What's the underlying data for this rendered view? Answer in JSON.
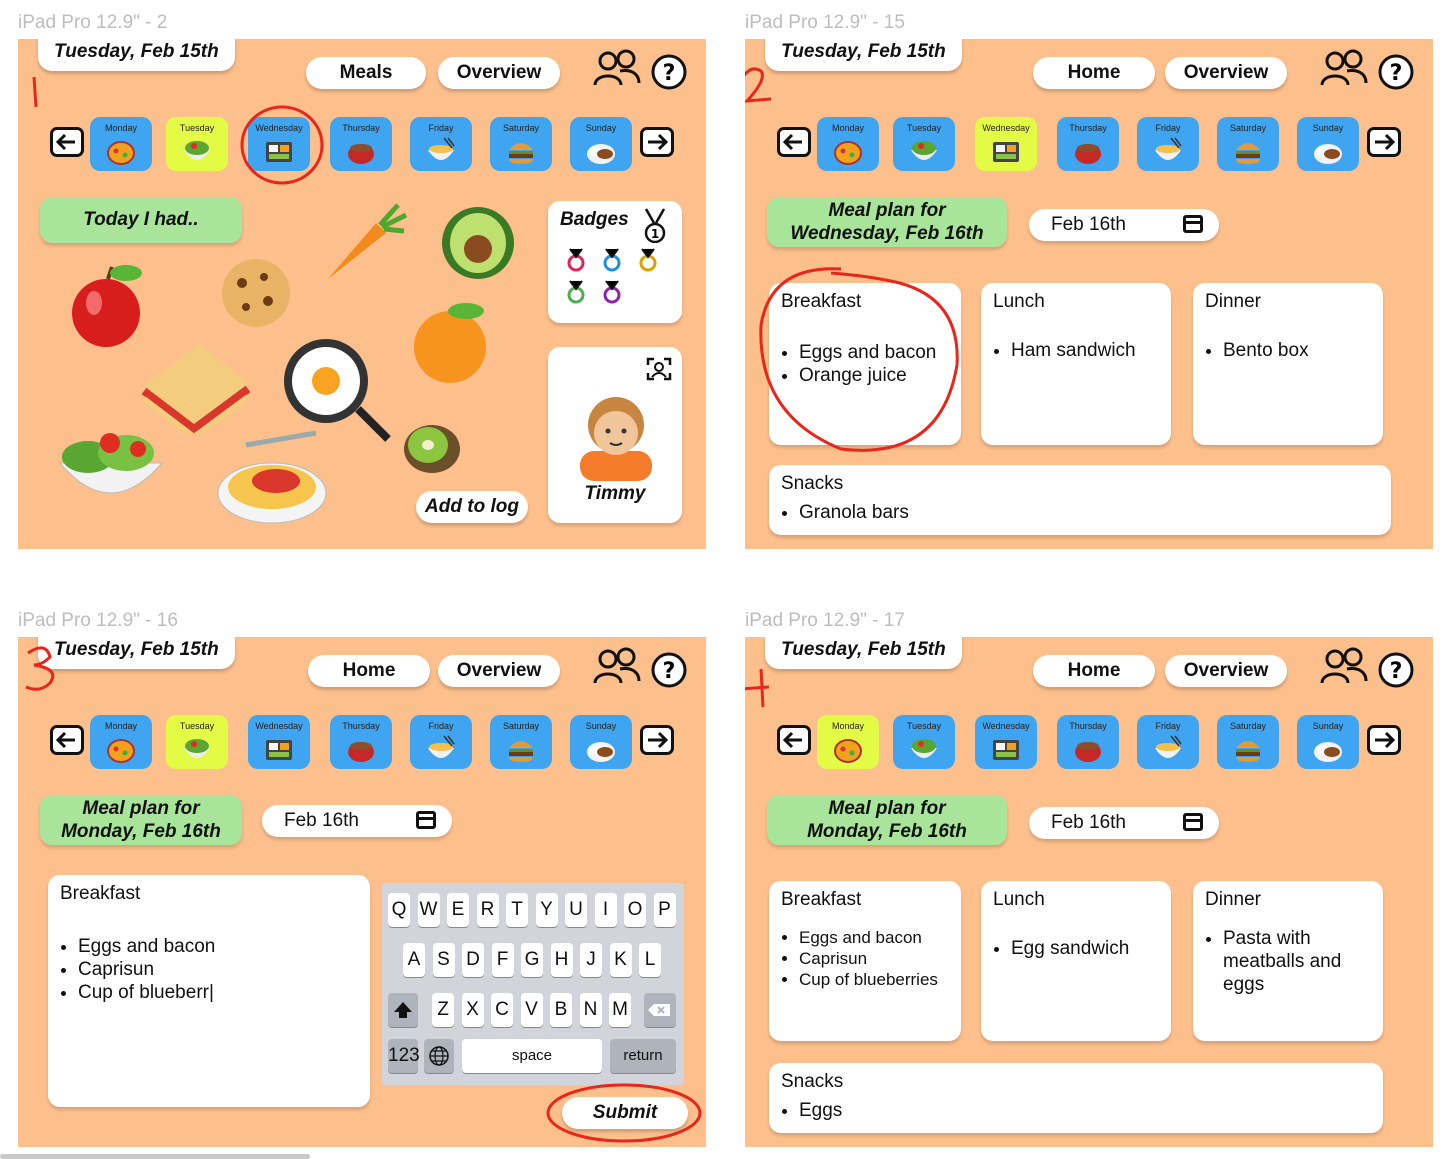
{
  "captions": [
    "iPad Pro 12.9\" - 2",
    "iPad Pro 12.9\" - 15",
    "iPad Pro 12.9\" - 16",
    "iPad Pro 12.9\" - 17"
  ],
  "annotations": [
    "1",
    "2",
    "3",
    "4"
  ],
  "header": {
    "date": "Tuesday, Feb 15th",
    "meals": "Meals",
    "home": "Home",
    "overview": "Overview"
  },
  "days": [
    "Monday",
    "Tuesday",
    "Wednesday",
    "Thursday",
    "Friday",
    "Saturday",
    "Sunday"
  ],
  "frame1": {
    "today_label": "Today I had..",
    "badges_title": "Badges",
    "add_to_log": "Add to log",
    "profile_name": "Timmy",
    "selected_day": "Tuesday",
    "circled_day": "Wednesday"
  },
  "frame2": {
    "plan_title_line1": "Meal plan for",
    "plan_title_line2": "Wednesday, Feb 16th",
    "date_field": "Feb 16th",
    "breakfast_title": "Breakfast",
    "breakfast": [
      "Eggs and bacon",
      "Orange juice"
    ],
    "lunch_title": "Lunch",
    "lunch": [
      "Ham sandwich"
    ],
    "dinner_title": "Dinner",
    "dinner": [
      "Bento box"
    ],
    "snacks_title": "Snacks",
    "snacks": [
      "Granola bars"
    ],
    "selected_day": "Wednesday"
  },
  "frame3": {
    "plan_title_line1": "Meal plan for",
    "plan_title_line2": "Monday, Feb 16th",
    "date_field": "Feb 16th",
    "breakfast_title": "Breakfast",
    "breakfast": [
      "Eggs and bacon",
      "Caprisun",
      "Cup of blueberr"
    ],
    "keyboard": {
      "row1": [
        "Q",
        "W",
        "E",
        "R",
        "T",
        "Y",
        "U",
        "I",
        "O",
        "P"
      ],
      "row2": [
        "A",
        "S",
        "D",
        "F",
        "G",
        "H",
        "J",
        "K",
        "L"
      ],
      "row3": [
        "Z",
        "X",
        "C",
        "V",
        "B",
        "N",
        "M"
      ],
      "num": "123",
      "space": "space",
      "return": "return"
    },
    "submit": "Submit",
    "selected_day": "Tuesday"
  },
  "frame4": {
    "plan_title_line1": "Meal plan for",
    "plan_title_line2": "Monday, Feb 16th",
    "date_field": "Feb 16th",
    "breakfast_title": "Breakfast",
    "breakfast": [
      "Eggs and bacon",
      "Caprisun",
      "Cup of blueberries"
    ],
    "lunch_title": "Lunch",
    "lunch": [
      "Egg sandwich"
    ],
    "dinner_title": "Dinner",
    "dinner": [
      "Pasta with meatballs and eggs"
    ],
    "snacks_title": "Snacks",
    "snacks": [
      "Eggs"
    ],
    "selected_day": "Monday"
  },
  "colors": {
    "frame_bg": "#fdbf8c",
    "day_tile": "#3fa5f0",
    "day_selected": "#e4fb46",
    "green_pill": "#a8e59a",
    "annotation_red": "#e8261b"
  }
}
